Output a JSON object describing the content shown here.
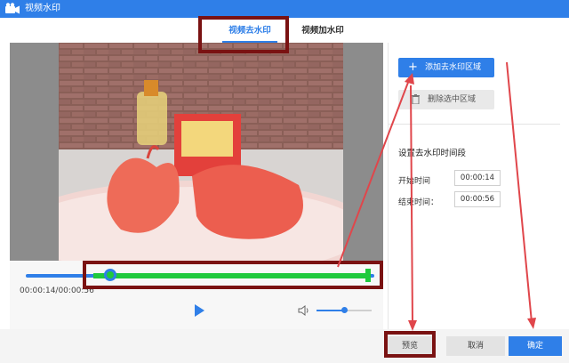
{
  "window": {
    "title": "视频水印"
  },
  "tabs": [
    {
      "label": "视频去水印",
      "active": true
    },
    {
      "label": "视频加水印",
      "active": false
    }
  ],
  "player": {
    "time_readout": "00:00:14/00:00:56",
    "range_start_fraction": 0.25,
    "range_end_fraction": 1.0,
    "volume_fraction": 0.5
  },
  "side": {
    "add_button": "添加去水印区域",
    "delete_button": "删除选中区域",
    "section_title": "设置去水印时间段",
    "start_label": "开始时间",
    "start_value": "00:00:14",
    "end_label": "结束时间：",
    "end_value": "00:00:56"
  },
  "footer": {
    "preview": "预览",
    "cancel": "取消",
    "confirm": "确定"
  },
  "colors": {
    "accent": "#2f7fe8",
    "range": "#1fc93d",
    "annotation_box": "#7a1212",
    "annotation_arrow": "#e0464b"
  },
  "icons": [
    "video-camera-icon",
    "plus-icon",
    "trash-icon",
    "play-icon",
    "volume-icon"
  ]
}
